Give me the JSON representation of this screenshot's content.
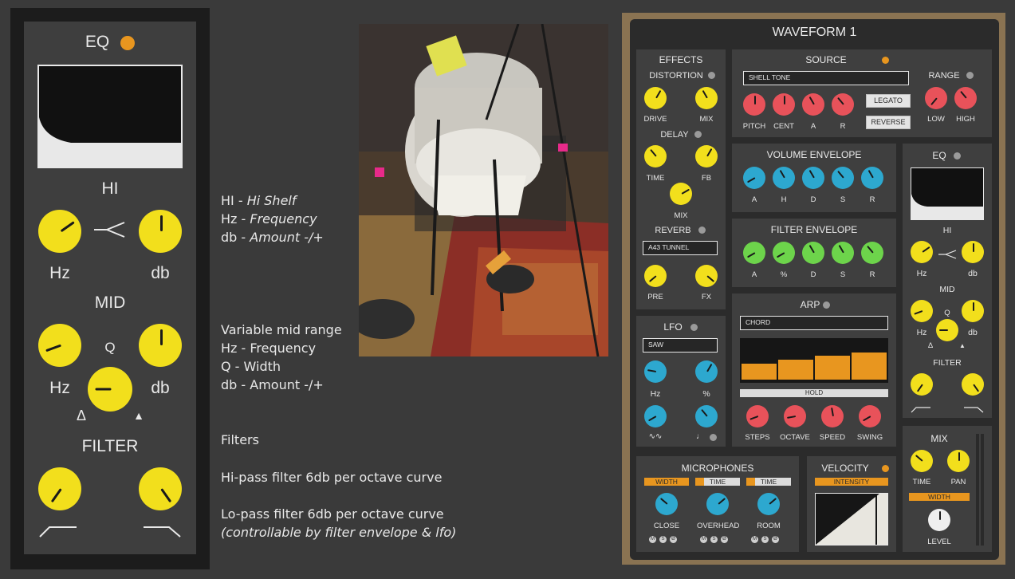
{
  "left": {
    "eq_title": "EQ",
    "hi_label": "HI",
    "hi_hz": "Hz",
    "hi_db": "db",
    "mid_label": "MID",
    "mid_q": "Q",
    "mid_hz": "Hz",
    "mid_db": "db",
    "filter_label": "FILTER",
    "triangle_open": "Δ",
    "triangle_filled": "▲"
  },
  "notes": {
    "hi_line1_prefix": "HI - ",
    "hi_line1_term": "Hi Shelf",
    "hi_line2_prefix": "Hz - ",
    "hi_line2_term": "Frequency",
    "hi_line3_prefix": "db - ",
    "hi_line3_term": "Amount -/+",
    "mid_line1": "Variable mid range",
    "mid_line2": "Hz - Frequency",
    "mid_line3": "Q - Width",
    "mid_line4": "db - Amount -/+",
    "filters_title": "Filters",
    "hipass": "Hi-pass filter 6db per octave curve",
    "lopass": "Lo-pass filter 6db per octave curve",
    "lopass_note": "(controllable by filter envelope & lfo)"
  },
  "plugin": {
    "title": "WAVEFORM 1",
    "effects": {
      "title": "EFFECTS",
      "distortion": "DISTORTION",
      "drive": "DRIVE",
      "mix": "MIX",
      "delay": "DELAY",
      "time": "TIME",
      "fb": "FB",
      "delay_mix": "MIX",
      "reverb": "REVERB",
      "reverb_preset": "A43 TUNNEL",
      "pre": "PRE",
      "fx": "FX"
    },
    "lfo": {
      "title": "LFO",
      "wave": "SAW",
      "hz": "Hz",
      "pct": "%",
      "wave_icon": "∿∿",
      "note_icon": "♩"
    },
    "source": {
      "title": "SOURCE",
      "preset": "SHELL TONE",
      "pitch": "PITCH",
      "cent": "CENT",
      "a": "A",
      "r": "R",
      "legato": "LEGATO",
      "reverse": "REVERSE",
      "range": "RANGE",
      "low": "LOW",
      "high": "HIGH"
    },
    "volume_env": {
      "title": "VOLUME ENVELOPE",
      "labels": [
        "A",
        "H",
        "D",
        "S",
        "R"
      ]
    },
    "filter_env": {
      "title": "FILTER ENVELOPE",
      "labels": [
        "A",
        "%",
        "D",
        "S",
        "R"
      ]
    },
    "arp": {
      "title": "ARP",
      "mode": "CHORD",
      "steps_values": [
        0.5,
        0.62,
        0.75,
        0.85
      ],
      "hold": "HOLD",
      "steps": "STEPS",
      "octave": "OCTAVE",
      "speed": "SPEED",
      "swing": "SWING"
    },
    "eq": {
      "title": "EQ",
      "hi": "HI",
      "hz": "Hz",
      "db": "db",
      "mid": "MID",
      "q": "Q",
      "mid_hz": "Hz",
      "mid_db": "db",
      "filter": "FILTER",
      "tri_open": "Δ",
      "tri_filled": "▲"
    },
    "mix": {
      "title": "MIX",
      "time": "TIME",
      "pan": "PAN",
      "width": "WIDTH",
      "level": "LEVEL"
    },
    "mics": {
      "title": "MICROPHONES",
      "bar1": "WIDTH",
      "bar2": "TIME",
      "bar3": "TIME",
      "close": "CLOSE",
      "overhead": "OVERHEAD",
      "room": "ROOM",
      "msd": [
        "M",
        "S",
        "Ø"
      ]
    },
    "velocity": {
      "title": "VELOCITY",
      "intensity": "INTENSITY"
    }
  },
  "colors": {
    "yellow": "#f2df1c",
    "red": "#e8525a",
    "blue": "#2da8cf",
    "green": "#6dd44b",
    "orange": "#e8961f",
    "white_knob": "#efefef"
  }
}
